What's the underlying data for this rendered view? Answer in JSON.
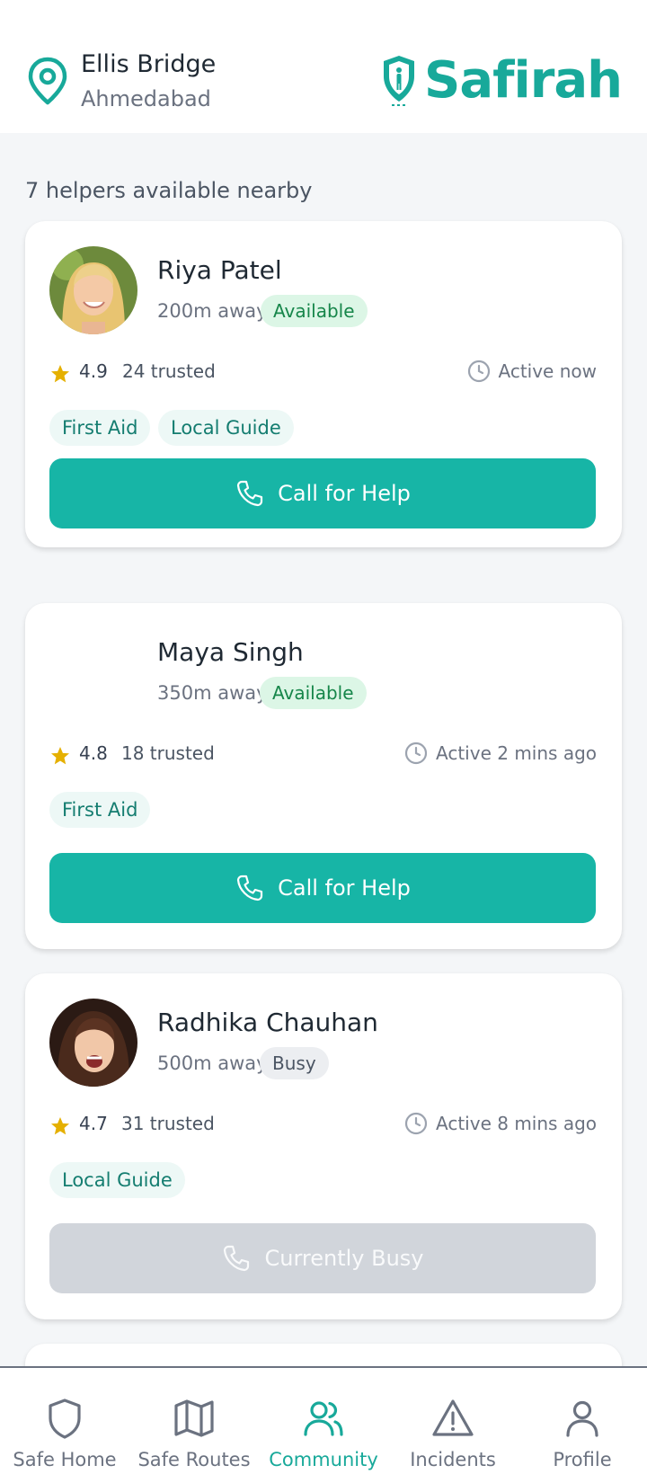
{
  "location": {
    "city": "Ellis Bridge",
    "region": "Ahmedabad"
  },
  "brand": {
    "name": "Safirah",
    "color": "#18a99a"
  },
  "helpers_summary": "7 helpers available nearby",
  "helpers": [
    {
      "name": "Riya Patel",
      "distance": "200m away",
      "status": "Available",
      "rating": "4.9",
      "trusted": "24 trusted",
      "active": "Active now",
      "tags": [
        "First Aid",
        "Local Guide"
      ],
      "action": "Call for Help"
    },
    {
      "name": "Maya Singh",
      "distance": "350m away",
      "status": "Available",
      "rating": "4.8",
      "trusted": "18 trusted",
      "active": "Active 2 mins ago",
      "tags": [
        "First Aid"
      ],
      "action": "Call for Help"
    },
    {
      "name": "Radhika Chauhan",
      "distance": "500m away",
      "status": "Busy",
      "rating": "4.7",
      "trusted": "31 trusted",
      "active": "Active 8 mins ago",
      "tags": [
        "Local Guide"
      ],
      "action": "Currently Busy"
    }
  ],
  "nav": [
    {
      "label": "Safe Home",
      "icon": "shield-icon"
    },
    {
      "label": "Safe Routes",
      "icon": "map-icon"
    },
    {
      "label": "Community",
      "icon": "users-icon",
      "active": true
    },
    {
      "label": "Incidents",
      "icon": "warning-icon"
    },
    {
      "label": "Profile",
      "icon": "user-icon"
    }
  ],
  "colors": {
    "accent": "#17b5a6",
    "available": "#16864a",
    "star": "#e5b000"
  }
}
